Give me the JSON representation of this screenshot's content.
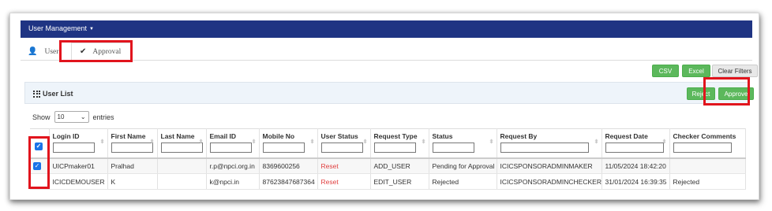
{
  "nav": {
    "menu_label": "User Management"
  },
  "tabs": [
    {
      "label": "User",
      "icon": "user-icon"
    },
    {
      "label": "Approval",
      "icon": "check-icon",
      "active": true
    }
  ],
  "export": {
    "csv": "CSV",
    "excel": "Excel",
    "clear": "Clear Filters"
  },
  "panel": {
    "title": "User List",
    "reject": "Reject",
    "approve": "Approve"
  },
  "length": {
    "show": "Show",
    "value": "10",
    "entries": "entries"
  },
  "table": {
    "columns": [
      "",
      "Login ID",
      "First Name",
      "Last Name",
      "Email ID",
      "Mobile No",
      "User Status",
      "Request Type",
      "Status",
      "Request By",
      "Request Date",
      "Checker Comments"
    ],
    "rows": [
      {
        "checked": true,
        "login": "UICPmaker01",
        "first": "Pralhad",
        "last": "",
        "email": "r.p@npci.org.in",
        "mobile": "8369600256",
        "user_status": "Reset",
        "request_type": "ADD_USER",
        "status": "Pending for Approval",
        "request_by": "ICICSPONSORADMINMAKER",
        "request_date": "11/05/2024 18:42:20",
        "comments": ""
      },
      {
        "checked": false,
        "login": "ICICDEMOUSER",
        "first": "K",
        "last": "",
        "email": "k@npci.in",
        "mobile": "87623847687364",
        "user_status": "Reset",
        "request_type": "EDIT_USER",
        "status": "Rejected",
        "request_by": "ICICSPONSORADMINCHECKER",
        "request_date": "31/01/2024 16:39:35",
        "comments": "Rejected"
      }
    ]
  },
  "colors": {
    "navbar": "#1f3483",
    "green": "#5cb85c",
    "highlight": "#e1141d",
    "checkbox": "#1a73e8",
    "reset": "#e04040"
  }
}
